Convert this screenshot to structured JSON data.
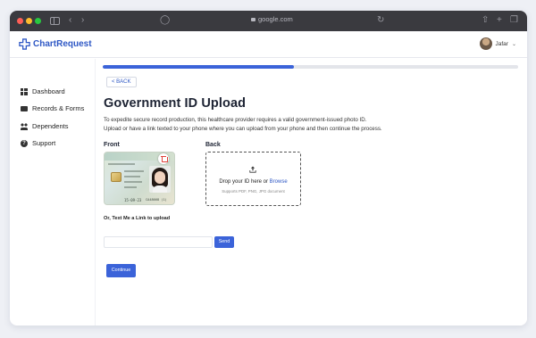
{
  "browser": {
    "url": "google.com"
  },
  "app": {
    "brand": "ChartRequest",
    "user_name": "Jafar"
  },
  "sidebar": {
    "items": [
      {
        "label": "Dashboard",
        "icon": "dashboard-icon"
      },
      {
        "label": "Records & Forms",
        "icon": "folder-icon"
      },
      {
        "label": "Dependents",
        "icon": "people-icon"
      },
      {
        "label": "Support",
        "icon": "help-icon"
      }
    ]
  },
  "main": {
    "progress_fraction": 0.46,
    "back_label": "< BACK",
    "title": "Government ID Upload",
    "description_line1": "To expedite secure record production, this healthcare provider requires a valid government-issued photo ID.",
    "description_line2": "Upload or have a link texted to your phone where you can upload from your phone and then continue the process.",
    "front_label": "Front",
    "back_side_label": "Back",
    "front_card": {
      "date_text": "15-09-23",
      "number_text": "CA48668 (1)"
    },
    "dropzone": {
      "main_text": "Drop your ID here or ",
      "browse_text": "Browse",
      "sub_text": "Supports PDF, PNG, JPG document"
    },
    "text_me_label": "Or, Text Me a Link to upload",
    "phone_input_value": "",
    "send_label": "Send",
    "continue_label": "Continue"
  },
  "colors": {
    "accent": "#3b63d9",
    "brand": "#2f58c5",
    "delete": "#e0413a"
  }
}
